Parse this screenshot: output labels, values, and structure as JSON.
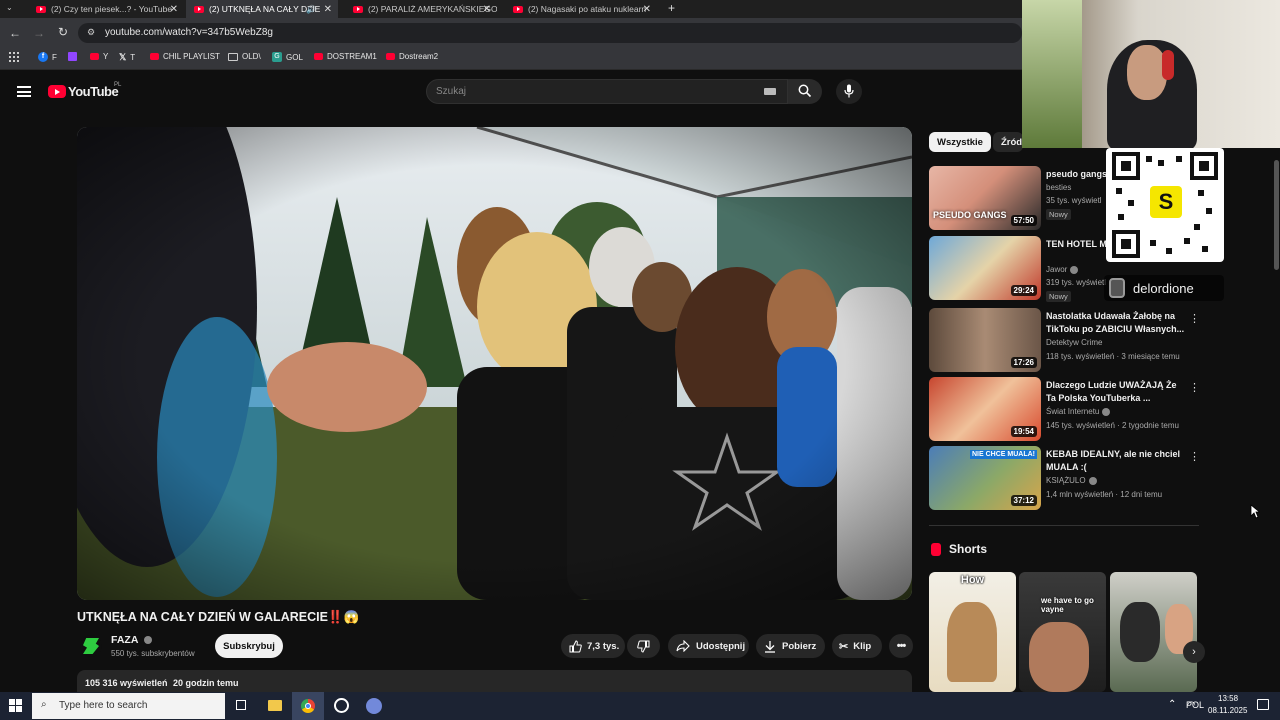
{
  "tabs": [
    {
      "title": "(2) Czy ten piesek...? - YouTube"
    },
    {
      "title": "(2) UTKNĘŁA NA CAŁY DZIE"
    },
    {
      "title": "(2) PARALIŻ AMERYKAŃSKIEGO"
    },
    {
      "title": "(2) Nagasaki po ataku nuklearn"
    }
  ],
  "address": {
    "url": "youtube.com/watch?v=347b5WebZ8g"
  },
  "bookmarks": [
    {
      "label": "F"
    },
    {
      "label": ""
    },
    {
      "label": "Y"
    },
    {
      "label": "T"
    },
    {
      "label": "CHIL PLAYLIST"
    },
    {
      "label": "OLD\\"
    },
    {
      "label": "GOL"
    },
    {
      "label": "DOSTREAM1"
    },
    {
      "label": "Dostream2"
    }
  ],
  "youtube": {
    "logo_text": "YouTube",
    "region": "PL",
    "search_placeholder": "Szukaj"
  },
  "video": {
    "title": "UTKNĘŁA NA CAŁY DZIEŃ W GALARECIE‼️😱",
    "channel": "FAZA",
    "subscribers": "550 tys. subskrybentów",
    "subscribe_label": "Subskrybuj",
    "likes": "7,3 tys.",
    "share_label": "Udostępnij",
    "download_label": "Pobierz",
    "clip_label": "Klip",
    "views": "105 316 wyświetleń",
    "age": "20 godzin temu"
  },
  "chips": [
    "Wszystkie",
    "Źródł"
  ],
  "recommendations": [
    {
      "title": "pseudo gangs",
      "channel": "besties",
      "meta": "35 tys. wyświetl",
      "badge": "Nowy",
      "duration": "57:50",
      "thumb_text": "PSEUDO GANGS"
    },
    {
      "title": "TEN HOTEL M... GWIAZDKOWA",
      "channel": "Jawor",
      "meta": "319 tys. wyświetl",
      "badge": "Nowy",
      "duration": "29:24",
      "thumb_text": ""
    },
    {
      "title": "Nastolatka Udawała Żałobę na TikToku po ZABICIU Własnych...",
      "channel": "Detektyw Crime",
      "meta": "118 tys. wyświetleń · 3 miesiące temu",
      "badge": "",
      "duration": "17:26",
      "thumb_text": ""
    },
    {
      "title": "Dlaczego Ludzie UWAŻAJĄ Że Ta Polska YouTuberka ...",
      "channel": "Świat Internetu",
      "meta": "145 tys. wyświetleń · 2 tygodnie temu",
      "badge": "",
      "duration": "19:54",
      "thumb_text": ""
    },
    {
      "title": "KEBAB IDEALNY, ale nie chciel MUALA :(",
      "channel": "KSIĄŻULO",
      "meta": "1,4 mln wyświetleń · 12 dni temu",
      "badge": "",
      "duration": "37:12",
      "thumb_text": "NIE CHCE MUALA!"
    }
  ],
  "shorts": {
    "heading": "Shorts",
    "items": [
      {
        "caption": "How"
      },
      {
        "caption": "we have to go vayne"
      },
      {
        "caption": ""
      }
    ]
  },
  "overlay": {
    "streamer_name": "delordione",
    "qr_letter": "S"
  },
  "taskbar": {
    "search_placeholder": "Type here to search",
    "language": "POL",
    "time": "13:58",
    "date": "08.11.2025"
  },
  "colors": {
    "accent_red": "#ff0033",
    "background": "#0f0f0f",
    "surface": "#272727"
  }
}
